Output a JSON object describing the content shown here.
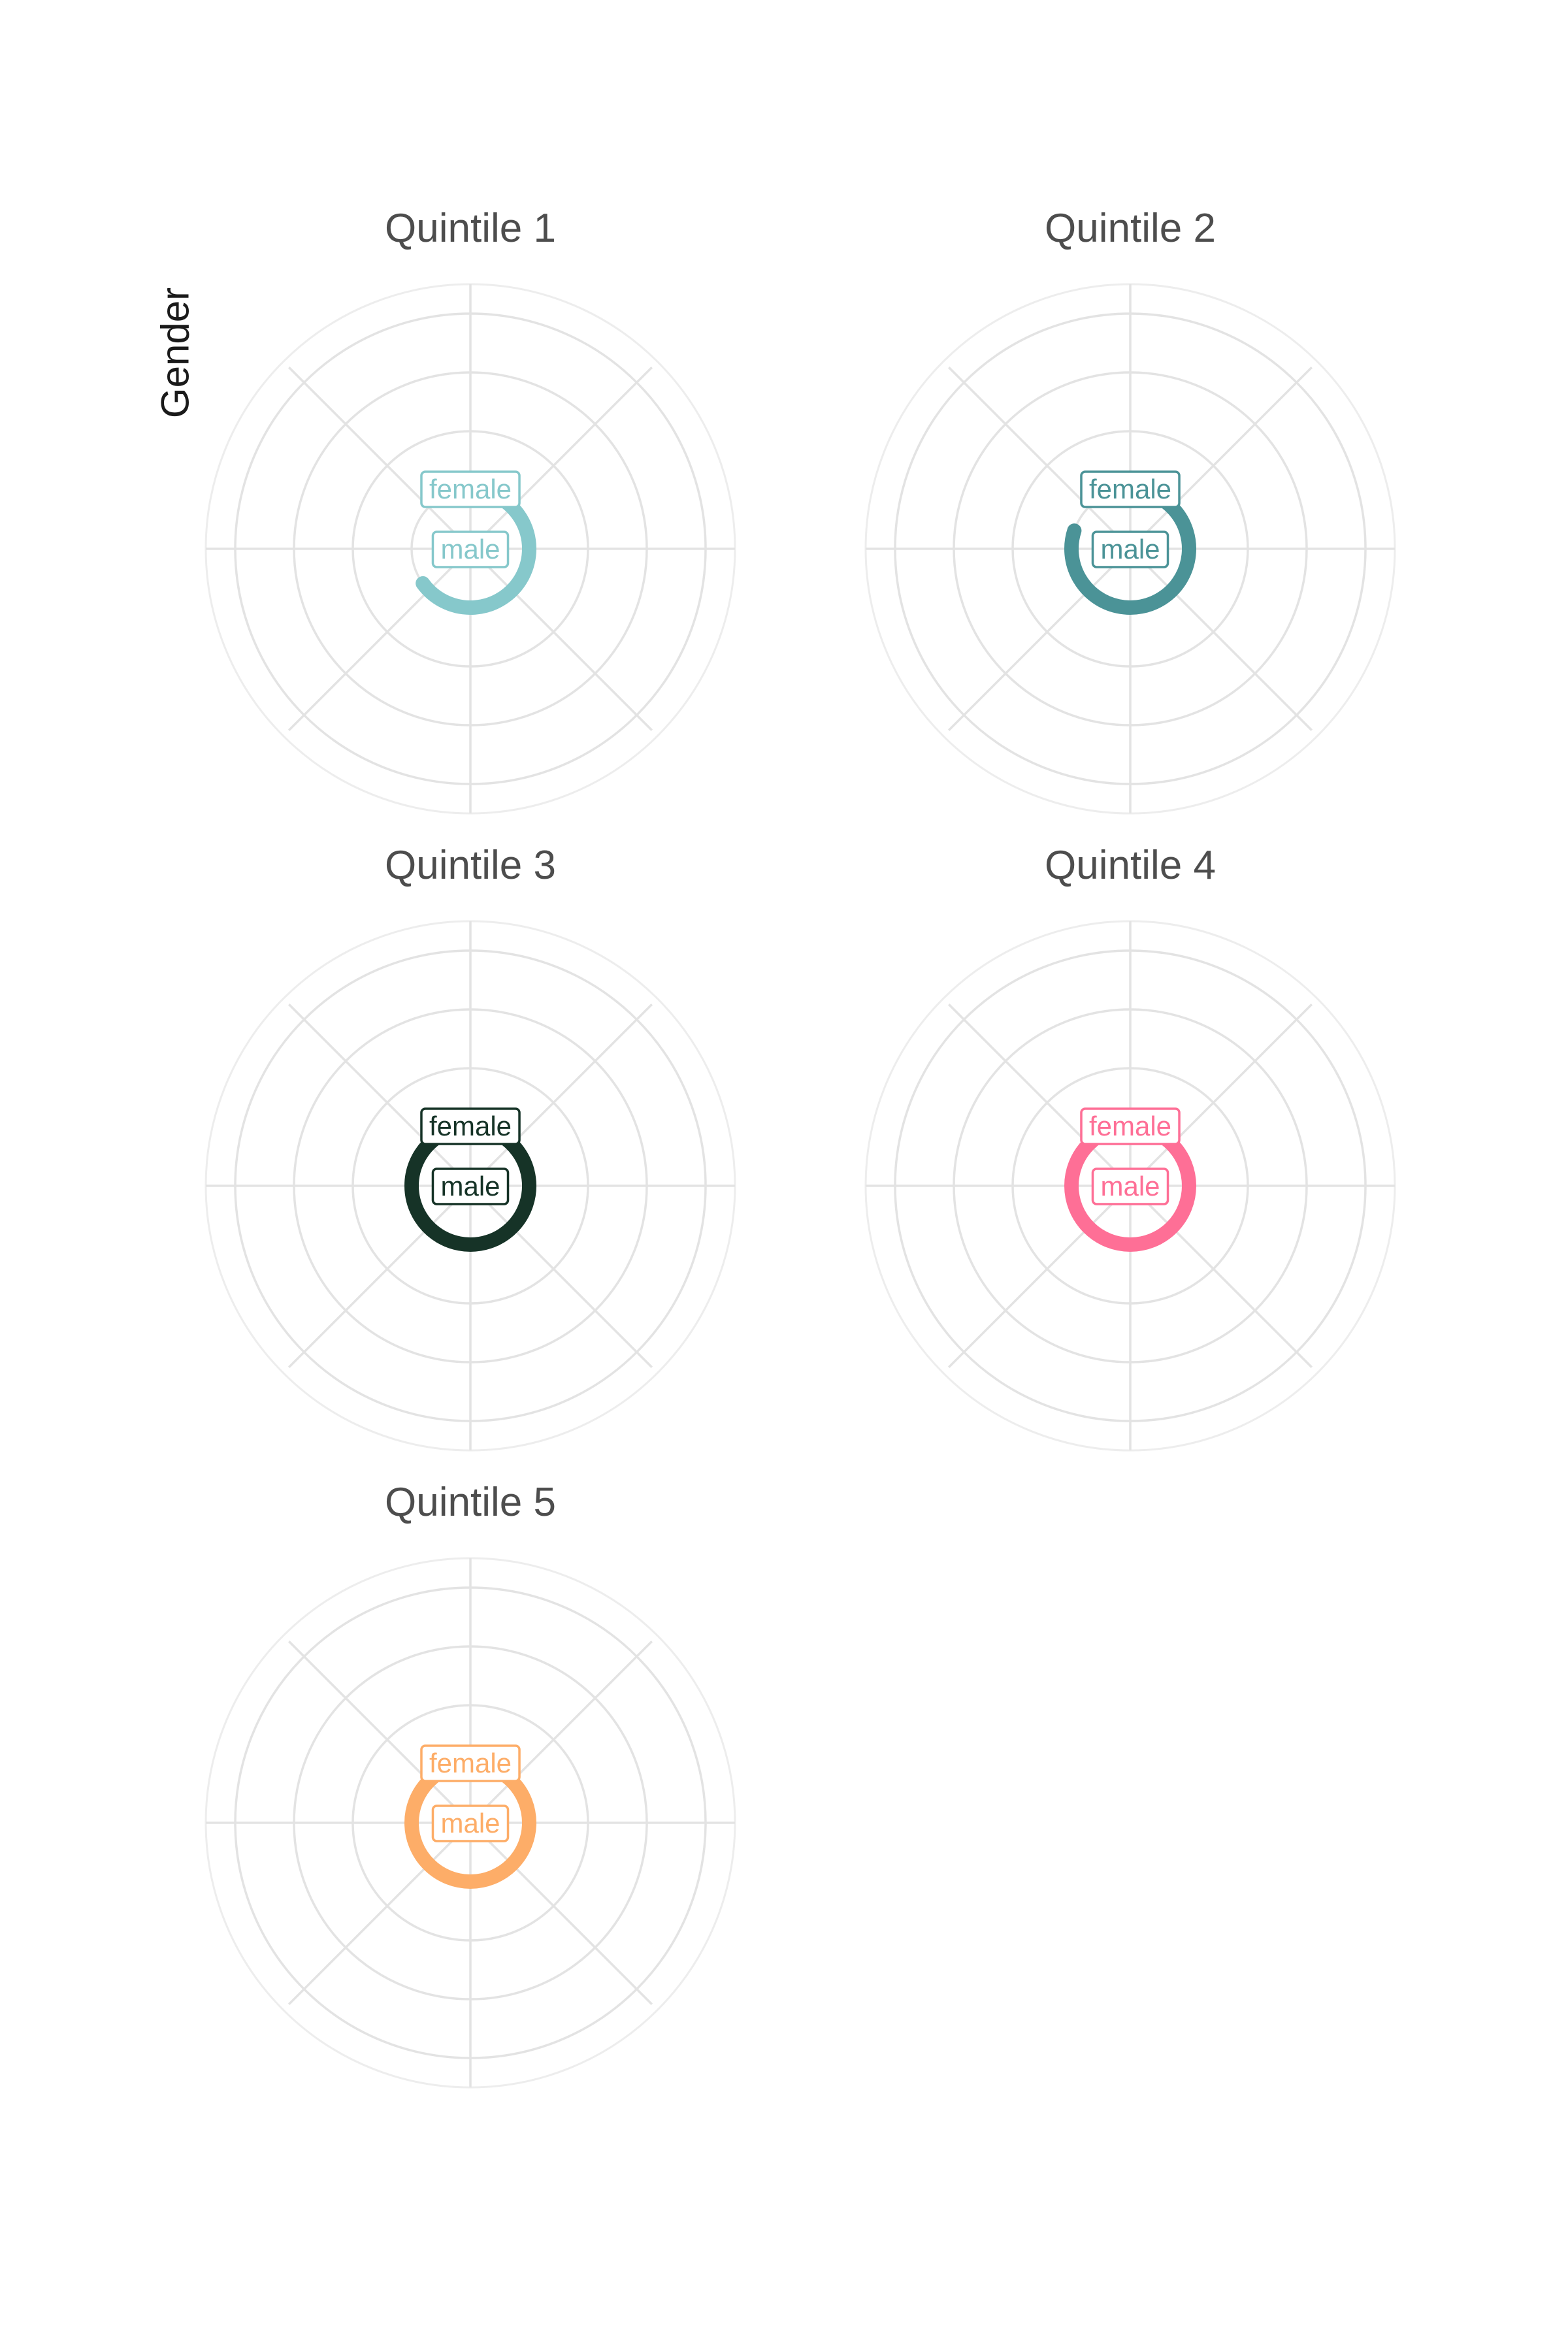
{
  "chart_data": {
    "type": "radial-bar",
    "ylabel": "Gender",
    "grid": true,
    "panels": [
      {
        "title": "Quintile 1",
        "color": "#86c8cb",
        "series": [
          {
            "name": "male",
            "value": 0.65
          },
          {
            "name": "female",
            "value": 0
          }
        ]
      },
      {
        "title": "Quintile 2",
        "color": "#4b9397",
        "series": [
          {
            "name": "male",
            "value": 0.8
          },
          {
            "name": "female",
            "value": 0
          }
        ]
      },
      {
        "title": "Quintile 3",
        "color": "#163327",
        "series": [
          {
            "name": "male",
            "value": 0.9
          },
          {
            "name": "female",
            "value": 0
          }
        ]
      },
      {
        "title": "Quintile 4",
        "color": "#fe6f96",
        "series": [
          {
            "name": "male",
            "value": 1.0
          },
          {
            "name": "female",
            "value": 0
          }
        ]
      },
      {
        "title": "Quintile 5",
        "color": "#fdad68",
        "series": [
          {
            "name": "male",
            "value": 1.0
          },
          {
            "name": "female",
            "value": 0
          }
        ]
      }
    ]
  }
}
